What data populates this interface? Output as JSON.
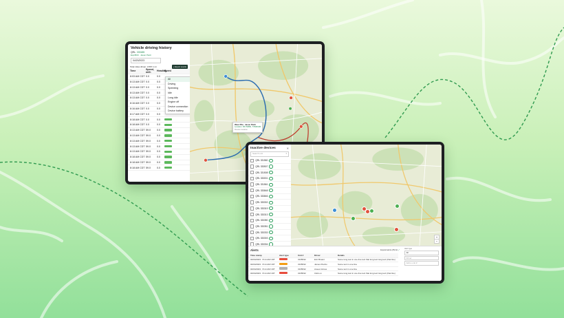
{
  "colors": {
    "accent": "#1b8a4e",
    "route": "#2b6cb0",
    "route_alt": "#c0392b",
    "pin_red": "#e0533d",
    "pin_green": "#4caf50",
    "badge_green": "#5cb85c",
    "bg_top": "#eaf9dc",
    "bg_bottom": "#92e09a"
  },
  "history": {
    "title": "Vehicle driving history",
    "unit_label": "QRL",
    "unit_value": "333185",
    "driver": "Expil500 · Jason Pietti",
    "date": "04/20/2023",
    "summary": "Total miles driven: 3,567.1 mi",
    "export_label": "Export results",
    "columns": [
      "Time",
      "Speed, mi/h",
      "Heading",
      "Event"
    ],
    "rows": [
      [
        "8:03 AM CDT",
        "0.0",
        "0.0",
        "All"
      ],
      [
        "8:13 AM CDT",
        "0.0",
        "0.0",
        "Driving"
      ],
      [
        "8:13 AM CDT",
        "0.0",
        "0.0",
        "Speeding"
      ],
      [
        "8:13 AM CDT",
        "0.0",
        "0.0",
        "Idle"
      ],
      [
        "8:13 AM CDT",
        "0.0",
        "0.0",
        "Long idle"
      ],
      [
        "8:16 AM CDT",
        "0.0",
        "0.0",
        "Engine off"
      ],
      [
        "8:16 AM CDT",
        "0.0",
        "0.0",
        "Device connection"
      ],
      [
        "8:17 AM CDT",
        "0.0",
        "0.0",
        "Device battery"
      ],
      [
        "8:18 AM CDT",
        "0.0",
        "0.0",
        ""
      ],
      [
        "8:18 AM CDT",
        "0.0",
        "0.0",
        ""
      ],
      [
        "8:13 AM CDT",
        "59.0",
        "0.0",
        ""
      ],
      [
        "8:13 AM CDT",
        "59.0",
        "0.0",
        ""
      ],
      [
        "8:13 AM CDT",
        "59.0",
        "0.0",
        ""
      ],
      [
        "8:13 AM CDT",
        "59.0",
        "0.0",
        ""
      ],
      [
        "8:13 AM CDT",
        "59.0",
        "0.0",
        ""
      ],
      [
        "8:18 AM CDT",
        "59.0",
        "0.0",
        ""
      ],
      [
        "8:18 AM CDT",
        "59.0",
        "0.0",
        ""
      ],
      [
        "8:18 AM CDT",
        "59.0",
        "0.0",
        ""
      ]
    ],
    "event_options": [
      "All",
      "Driving",
      "Speeding",
      "Idle",
      "Long idle",
      "Engine off",
      "Device connection",
      "Device battery"
    ],
    "popup": {
      "line1": "Wear Pila  ·  Jason Pietti",
      "line2": "Location: 86 P4866, TXMKMM",
      "line3": "Device location"
    }
  },
  "devices": {
    "title": "Inactive devices",
    "search_placeholder": "Search unit",
    "items": [
      "QRL 331560",
      "QRL 333507",
      "QRL 331508",
      "QRL 333001",
      "QRL 331561",
      "QRL 333848",
      "QRL 333846",
      "QRL 333302",
      "QRL 333319",
      "QRL 333313",
      "QRL 333350",
      "QRL 333351",
      "QRL 333333",
      "QRL 333303",
      "QRL 333304",
      "QRL 333305"
    ],
    "expand_label": "Expand alerts (25) list"
  },
  "alerts": {
    "title": "Alerts",
    "columns": [
      "Time stamp",
      "Alert type",
      "Unit #",
      "Driver",
      "Details"
    ],
    "rows": [
      {
        "time": "04/04/2023 · 8:14 AM CDT",
        "type_color": "#e74c3c",
        "unit": "3135632",
        "driver": "Eric Bruant",
        "details": "Some long text in one line text that long text long text (that line)"
      },
      {
        "time": "04/04/2023 · 8:14 AM CDT",
        "type_color": "#f39c12",
        "unit": "3135632",
        "driver": "James Pierlco",
        "details": "Some text in one line"
      },
      {
        "time": "04/04/2023 · 8:14 AM CDT",
        "type_color": "#b0b0b0",
        "unit": "3135632",
        "driver": "Anees Grines",
        "details": "Some text in one line"
      },
      {
        "time": "04/04/2023 · 8:14 AM CDT",
        "type_color": "#e74c3c",
        "unit": "3135632",
        "driver": "Click on",
        "details": "Some long text in one line text that long text long text (that line)"
      }
    ],
    "filter": {
      "label": "Alert type",
      "value": "All",
      "driver_placeholder": "Driver",
      "unit_placeholder": "Add a unit #"
    }
  }
}
